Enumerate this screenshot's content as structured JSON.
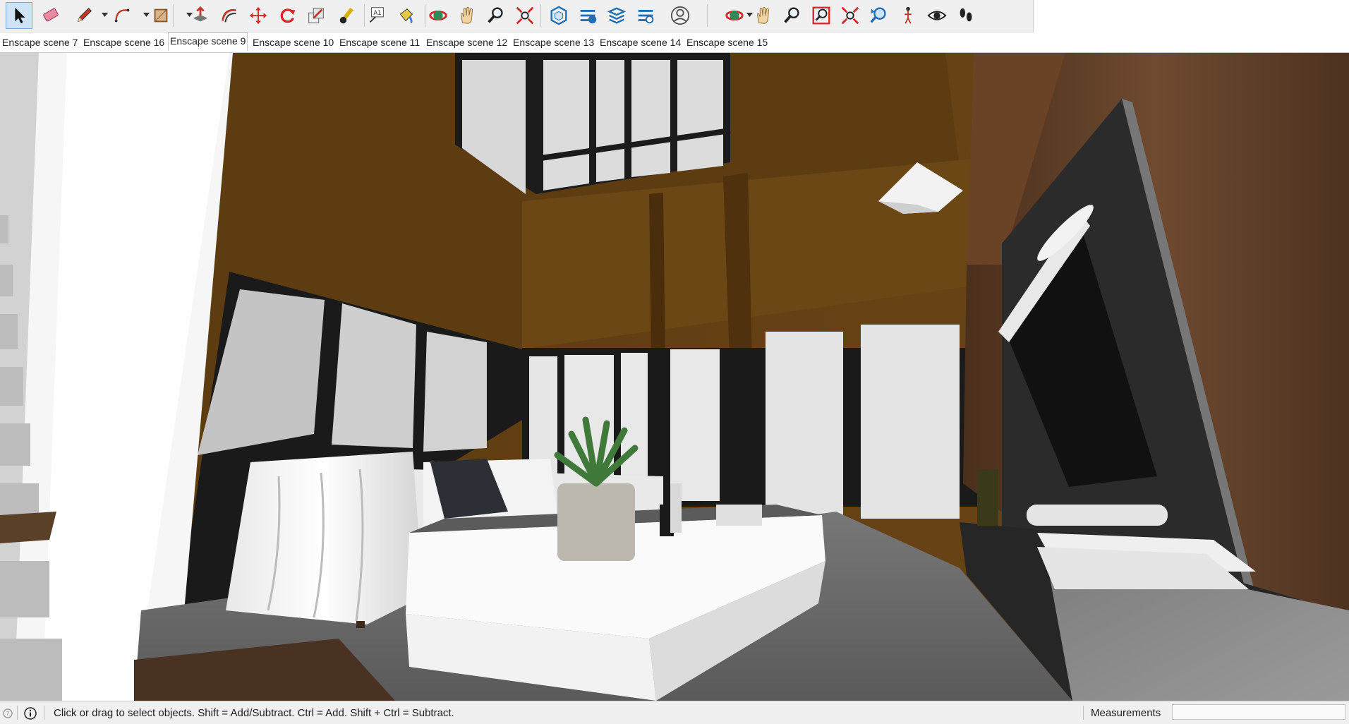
{
  "toolbar": {
    "tools": [
      {
        "name": "select",
        "icon": "select-arrow-icon",
        "active": true
      },
      {
        "name": "eraser",
        "icon": "eraser-icon"
      },
      {
        "name": "line",
        "icon": "pencil-icon",
        "dropdown": true
      },
      {
        "name": "arc",
        "icon": "arc-icon",
        "dropdown": true
      },
      {
        "name": "rectangle",
        "icon": "rectangle-icon",
        "dropdown": true
      },
      {
        "name": "push-pull",
        "icon": "push-pull-icon"
      },
      {
        "name": "offset",
        "icon": "offset-icon"
      },
      {
        "name": "move",
        "icon": "move-icon"
      },
      {
        "name": "rotate",
        "icon": "rotate-icon"
      },
      {
        "name": "scale",
        "icon": "scale-icon"
      },
      {
        "name": "tape-measure",
        "icon": "tape-measure-icon"
      },
      {
        "name": "text",
        "icon": "text-icon"
      },
      {
        "name": "paint-bucket",
        "icon": "paint-bucket-icon"
      },
      {
        "name": "orbit",
        "icon": "orbit-icon"
      },
      {
        "name": "pan",
        "icon": "pan-hand-icon"
      },
      {
        "name": "zoom",
        "icon": "zoom-icon"
      },
      {
        "name": "zoom-extents",
        "icon": "zoom-extents-icon"
      },
      {
        "name": "warehouse",
        "icon": "3d-warehouse-icon"
      },
      {
        "name": "share-model",
        "icon": "share-model-icon"
      },
      {
        "name": "extension-warehouse",
        "icon": "extension-warehouse-icon"
      },
      {
        "name": "extension-manager",
        "icon": "extension-manager-icon"
      },
      {
        "name": "account",
        "icon": "account-icon",
        "dropdown": true
      },
      {
        "name": "orbit-2",
        "icon": "orbit-icon"
      },
      {
        "name": "pan-2",
        "icon": "pan-hand-icon"
      },
      {
        "name": "zoom-2",
        "icon": "zoom-icon"
      },
      {
        "name": "zoom-window",
        "icon": "zoom-window-icon"
      },
      {
        "name": "zoom-extents-2",
        "icon": "zoom-extents-icon"
      },
      {
        "name": "previous-view",
        "icon": "previous-view-icon"
      },
      {
        "name": "position-camera",
        "icon": "position-camera-icon"
      },
      {
        "name": "look-around",
        "icon": "look-around-eye-icon"
      },
      {
        "name": "walk",
        "icon": "walk-footprints-icon"
      }
    ]
  },
  "scene_tabs": [
    "Enscape scene 7",
    "Enscape scene 16",
    "Enscape scene 9",
    "Enscape scene 10",
    "Enscape scene 11",
    "Enscape scene 12",
    "Enscape scene 13",
    "Enscape scene 14",
    "Enscape scene 15"
  ],
  "active_tab": "Enscape scene 9",
  "status": {
    "message": "Click or drag to select objects. Shift = Add/Subtract. Ctrl = Add. Shift + Ctrl = Subtract.",
    "measurements_label": "Measurements",
    "measurements_value": ""
  },
  "colors": {
    "wood_dark": "#5a3a12",
    "wood_panel": "#6b4a2a",
    "window_frame": "#1e1e1e",
    "glass": "#d9d9d9",
    "floor": "#6e6e6e",
    "accent_select": "#cfe3f7"
  }
}
